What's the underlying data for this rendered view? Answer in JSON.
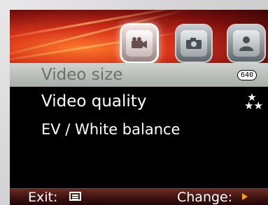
{
  "header": {
    "tabs": [
      {
        "name": "video",
        "icon": "video-camera-icon",
        "selected": true
      },
      {
        "name": "photo",
        "icon": "camera-icon",
        "selected": false
      },
      {
        "name": "settings",
        "icon": "person-settings-icon",
        "selected": false
      }
    ]
  },
  "menu": {
    "items": [
      {
        "label": "Video size",
        "value_badge": "640",
        "selected": true
      },
      {
        "label": "Video quality",
        "value_icon": "stars-icon",
        "selected": false
      },
      {
        "label": "EV / White balance",
        "selected": false
      }
    ]
  },
  "footer": {
    "exit_label": "Exit:",
    "exit_icon": "menu-icon",
    "change_label": "Change:",
    "change_icon": "right-arrow-icon"
  },
  "colors": {
    "header_red": "#c22a1a",
    "selected_row": "#b9beb9",
    "selected_text": "#6e706e",
    "arrow_orange": "#f4a300"
  }
}
